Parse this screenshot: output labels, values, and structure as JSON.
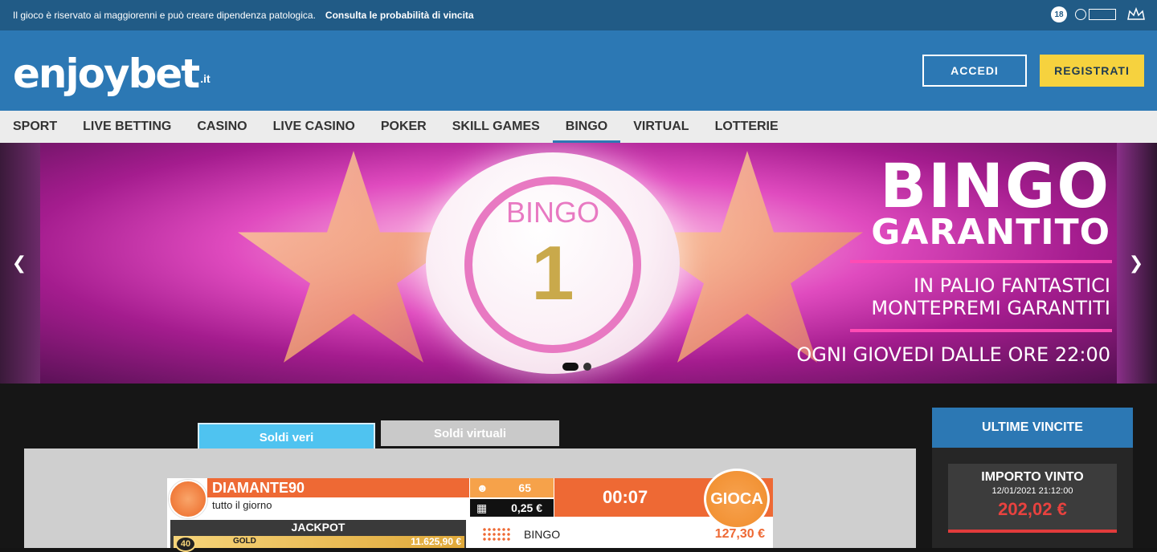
{
  "topbar": {
    "disclaimer": "Il gioco è riservato ai maggiorenni e può creare dipendenza patologica.",
    "odds_link": "Consulta le probabilità di vincita",
    "age_badge": "18"
  },
  "header": {
    "logo_brand": "enjoybet",
    "logo_tld": ".it",
    "login_label": "ACCEDI",
    "register_label": "REGISTRATI",
    "colors": {
      "bar": "#2c78b4",
      "register": "#f6d23e"
    }
  },
  "nav": {
    "items": [
      {
        "label": "SPORT"
      },
      {
        "label": "LIVE BETTING"
      },
      {
        "label": "CASINO"
      },
      {
        "label": "LIVE CASINO"
      },
      {
        "label": "POKER"
      },
      {
        "label": "SKILL GAMES"
      },
      {
        "label": "BINGO",
        "active": true
      },
      {
        "label": "VIRTUAL"
      },
      {
        "label": "LOTTERIE"
      }
    ]
  },
  "hero": {
    "ball_text": "BINGO",
    "ball_number": "1",
    "title1": "BINGO",
    "title2": "GARANTITO",
    "sub1": "IN PALIO FANTASTICI",
    "sub2": "MONTEPREMI GARANTITI",
    "sub3": "OGNI GIOVEDI DALLE ORE 22:00",
    "prev_icon": "chevron-left-icon",
    "next_icon": "chevron-right-icon",
    "slides": 2,
    "active_slide": 1
  },
  "tabs": {
    "real": "Soldi veri",
    "virtual": "Soldi virtuali"
  },
  "game": {
    "name": "DIAMANTE90",
    "schedule": "tutto il giorno",
    "players": "65",
    "price": "0,25 €",
    "timer": "00:07",
    "play_label": "GIOCA",
    "jackpot_title": "JACKPOT",
    "jackpot_level": "40",
    "jackpot_tier": "GOLD",
    "jackpot_amount": "11.625,90 €",
    "prize_label": "BINGO",
    "prize_value": "127,30 €"
  },
  "winners": {
    "title": "ULTIME VINCITE",
    "label": "IMPORTO VINTO",
    "date": "12/01/2021 21:12:00",
    "amount": "202,02 €"
  }
}
